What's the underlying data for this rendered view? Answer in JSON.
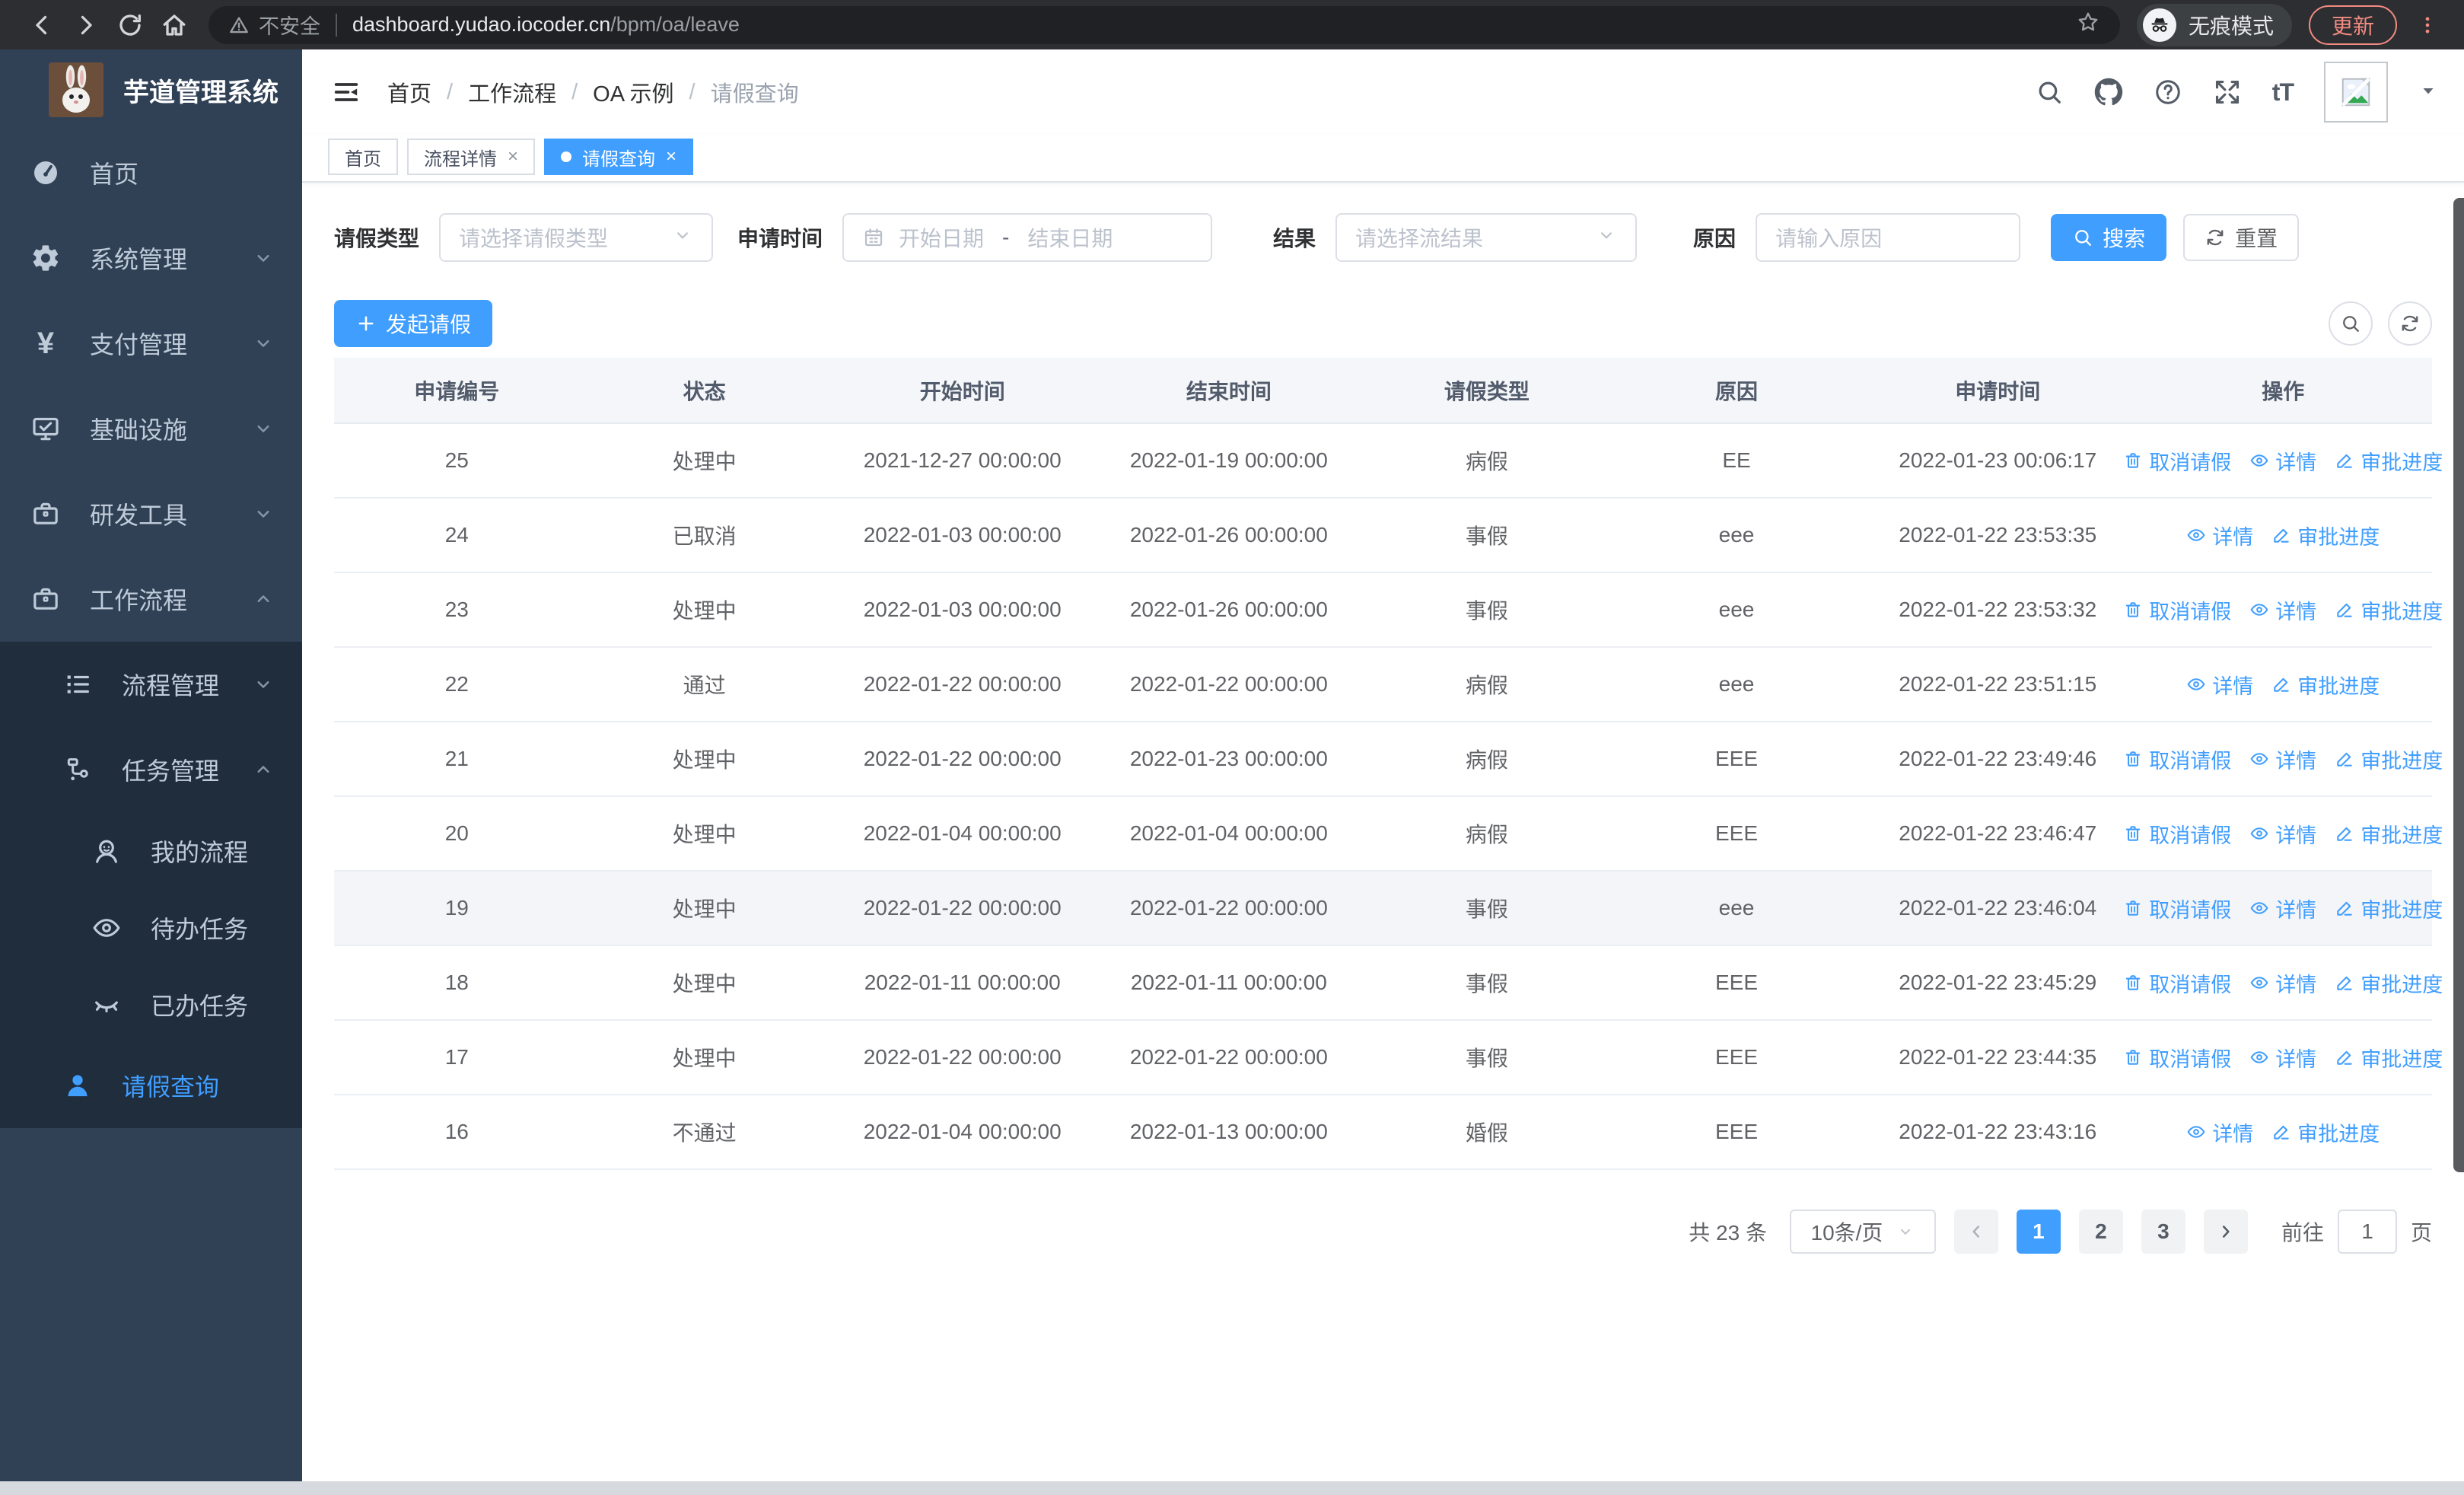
{
  "colors": {
    "accent": "#409eff",
    "sidebar_bg": "#304156",
    "sidebar_sub_bg": "#1f2d3d",
    "update_accent": "#f28b82",
    "table_header_bg": "#f5f7fa"
  },
  "browser": {
    "security_label": "不安全",
    "url_host": "dashboard.yudao.iocoder.cn",
    "url_path": "/bpm/oa/leave",
    "incognito_label": "无痕模式",
    "update_label": "更新"
  },
  "sidebar": {
    "app_title": "芋道管理系统",
    "items": [
      {
        "slug": "home",
        "label": "首页",
        "icon": "gauge",
        "level": 1,
        "chevron": null,
        "active": false
      },
      {
        "slug": "system-management",
        "label": "系统管理",
        "icon": "gear",
        "level": 1,
        "chevron": "down",
        "active": false
      },
      {
        "slug": "payment-management",
        "label": "支付管理",
        "icon": "yen",
        "level": 1,
        "chevron": "down",
        "active": false
      },
      {
        "slug": "infrastructure",
        "label": "基础设施",
        "icon": "monitor-check",
        "level": 1,
        "chevron": "down",
        "active": false
      },
      {
        "slug": "dev-tools",
        "label": "研发工具",
        "icon": "briefcase",
        "level": 1,
        "chevron": "down",
        "active": false
      },
      {
        "slug": "workflow",
        "label": "工作流程",
        "icon": "briefcase",
        "level": 1,
        "chevron": "up",
        "active": false
      },
      {
        "slug": "process-management",
        "label": "流程管理",
        "icon": "list",
        "level": 2,
        "chevron": "down",
        "active": false
      },
      {
        "slug": "task-management",
        "label": "任务管理",
        "icon": "flow",
        "level": 2,
        "chevron": "up",
        "active": false
      },
      {
        "slug": "my-process",
        "label": "我的流程",
        "icon": "user-face",
        "level": 3,
        "chevron": null,
        "active": false
      },
      {
        "slug": "todo-tasks",
        "label": "待办任务",
        "icon": "eye",
        "level": 3,
        "chevron": null,
        "active": false
      },
      {
        "slug": "done-tasks",
        "label": "已办任务",
        "icon": "eye-closed",
        "level": 3,
        "chevron": null,
        "active": false
      },
      {
        "slug": "leave-query",
        "label": "请假查询",
        "icon": "user-filled",
        "level": 2,
        "chevron": null,
        "active": true
      }
    ]
  },
  "breadcrumb": {
    "items": [
      "首页",
      "工作流程",
      "OA 示例",
      "请假查询"
    ]
  },
  "tabs": [
    {
      "slug": "home",
      "label": "首页",
      "closable": false,
      "active": false
    },
    {
      "slug": "process-detail",
      "label": "流程详情",
      "closable": true,
      "active": false
    },
    {
      "slug": "leave-query",
      "label": "请假查询",
      "closable": true,
      "active": true
    }
  ],
  "filters": {
    "leave_type": {
      "label": "请假类型",
      "placeholder": "请选择请假类型"
    },
    "apply_time": {
      "label": "申请时间",
      "start_placeholder": "开始日期",
      "separator": "-",
      "end_placeholder": "结束日期"
    },
    "result": {
      "label": "结果",
      "placeholder": "请选择流结果"
    },
    "reason": {
      "label": "原因",
      "placeholder": "请输入原因"
    },
    "search_label": "搜索",
    "reset_label": "重置"
  },
  "toolbar": {
    "create_label": "发起请假"
  },
  "table": {
    "columns": [
      "申请编号",
      "状态",
      "开始时间",
      "结束时间",
      "请假类型",
      "原因",
      "申请时间",
      "操作"
    ],
    "action_labels": {
      "cancel": "取消请假",
      "detail": "详情",
      "progress": "审批进度"
    },
    "rows": [
      {
        "id": "25",
        "status": "处理中",
        "start": "2021-12-27 00:00:00",
        "end": "2022-01-19 00:00:00",
        "type": "病假",
        "reason": "EE",
        "applied": "2022-01-23 00:06:17",
        "actions": [
          "cancel",
          "detail",
          "progress"
        ],
        "highlight": false
      },
      {
        "id": "24",
        "status": "已取消",
        "start": "2022-01-03 00:00:00",
        "end": "2022-01-26 00:00:00",
        "type": "事假",
        "reason": "eee",
        "applied": "2022-01-22 23:53:35",
        "actions": [
          "detail",
          "progress"
        ],
        "highlight": false
      },
      {
        "id": "23",
        "status": "处理中",
        "start": "2022-01-03 00:00:00",
        "end": "2022-01-26 00:00:00",
        "type": "事假",
        "reason": "eee",
        "applied": "2022-01-22 23:53:32",
        "actions": [
          "cancel",
          "detail",
          "progress"
        ],
        "highlight": false
      },
      {
        "id": "22",
        "status": "通过",
        "start": "2022-01-22 00:00:00",
        "end": "2022-01-22 00:00:00",
        "type": "病假",
        "reason": "eee",
        "applied": "2022-01-22 23:51:15",
        "actions": [
          "detail",
          "progress"
        ],
        "highlight": false
      },
      {
        "id": "21",
        "status": "处理中",
        "start": "2022-01-22 00:00:00",
        "end": "2022-01-23 00:00:00",
        "type": "病假",
        "reason": "EEE",
        "applied": "2022-01-22 23:49:46",
        "actions": [
          "cancel",
          "detail",
          "progress"
        ],
        "highlight": false
      },
      {
        "id": "20",
        "status": "处理中",
        "start": "2022-01-04 00:00:00",
        "end": "2022-01-04 00:00:00",
        "type": "病假",
        "reason": "EEE",
        "applied": "2022-01-22 23:46:47",
        "actions": [
          "cancel",
          "detail",
          "progress"
        ],
        "highlight": false
      },
      {
        "id": "19",
        "status": "处理中",
        "start": "2022-01-22 00:00:00",
        "end": "2022-01-22 00:00:00",
        "type": "事假",
        "reason": "eee",
        "applied": "2022-01-22 23:46:04",
        "actions": [
          "cancel",
          "detail",
          "progress"
        ],
        "highlight": true
      },
      {
        "id": "18",
        "status": "处理中",
        "start": "2022-01-11 00:00:00",
        "end": "2022-01-11 00:00:00",
        "type": "事假",
        "reason": "EEE",
        "applied": "2022-01-22 23:45:29",
        "actions": [
          "cancel",
          "detail",
          "progress"
        ],
        "highlight": false
      },
      {
        "id": "17",
        "status": "处理中",
        "start": "2022-01-22 00:00:00",
        "end": "2022-01-22 00:00:00",
        "type": "事假",
        "reason": "EEE",
        "applied": "2022-01-22 23:44:35",
        "actions": [
          "cancel",
          "detail",
          "progress"
        ],
        "highlight": false
      },
      {
        "id": "16",
        "status": "不通过",
        "start": "2022-01-04 00:00:00",
        "end": "2022-01-13 00:00:00",
        "type": "婚假",
        "reason": "EEE",
        "applied": "2022-01-22 23:43:16",
        "actions": [
          "detail",
          "progress"
        ],
        "highlight": false
      }
    ]
  },
  "pagination": {
    "total_label": "共 23 条",
    "page_size_label": "10条/页",
    "pages": [
      "1",
      "2",
      "3"
    ],
    "active_page": "1",
    "goto_label": "前往",
    "goto_value": "1",
    "page_suffix": "页"
  }
}
